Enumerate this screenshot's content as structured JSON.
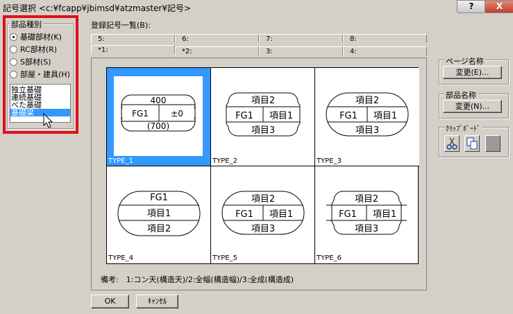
{
  "window": {
    "title": "記号選択 <c:¥fcapp¥jbimsd¥atzmaster¥記号>",
    "help_label": "?",
    "close_label": "X"
  },
  "part_type": {
    "legend": "部品種別",
    "options": [
      {
        "label": "基礎部材(K)",
        "selected": true
      },
      {
        "label": "RC部材(R)",
        "selected": false
      },
      {
        "label": "S部材(S)",
        "selected": false
      },
      {
        "label": "部屋・建具(H)",
        "selected": false
      }
    ],
    "list_items": [
      {
        "label": "独立基礎",
        "selected": false
      },
      {
        "label": "連続基礎",
        "selected": false
      },
      {
        "label": "べた基礎",
        "selected": false
      },
      {
        "label": "基礎梁",
        "selected": true
      }
    ]
  },
  "registered_list": {
    "label": "登録記号一覧(B):",
    "tabs_back": [
      "5:",
      "6:",
      "7:",
      "8:"
    ],
    "tabs_front": [
      "*1:",
      "*2:",
      "3:",
      "4:"
    ]
  },
  "symbols": [
    {
      "label": "TYPE_1",
      "selected": true,
      "rows": [
        "400",
        "FG1",
        "±0",
        "(700)"
      ]
    },
    {
      "label": "TYPE_2",
      "selected": false,
      "rows": [
        "項目2",
        "FG1",
        "項目1",
        "項目3"
      ]
    },
    {
      "label": "TYPE_3",
      "selected": false,
      "rows": [
        "項目2",
        "FG1",
        "項目1",
        "項目3"
      ]
    },
    {
      "label": "TYPE_4",
      "selected": false,
      "rows": [
        "FG1",
        "項目1",
        "項目2"
      ]
    },
    {
      "label": "TYPE_5",
      "selected": false,
      "rows": [
        "項目2",
        "FG1",
        "項目1",
        "項目3"
      ]
    },
    {
      "label": "TYPE_6",
      "selected": false,
      "rows": [
        "項目2",
        "FG1",
        "項目1",
        "項目3"
      ]
    }
  ],
  "remarks": "備考:　1:コン天(構造天)/2:全幅(構造幅)/3:全成(構造成)",
  "page_name": {
    "legend": "ページ名称",
    "button": "変更(E)..."
  },
  "part_name": {
    "legend": "部品名称",
    "button": "変更(N)..."
  },
  "clipboard": {
    "legend": "ｸﾘｯﾌﾟﾎﾞｰﾄﾞ",
    "icons": [
      "cut-icon",
      "copy-icon",
      "paste-icon"
    ]
  },
  "footer": {
    "ok": "OK",
    "cancel": "ｷｬﾝｾﾙ"
  }
}
